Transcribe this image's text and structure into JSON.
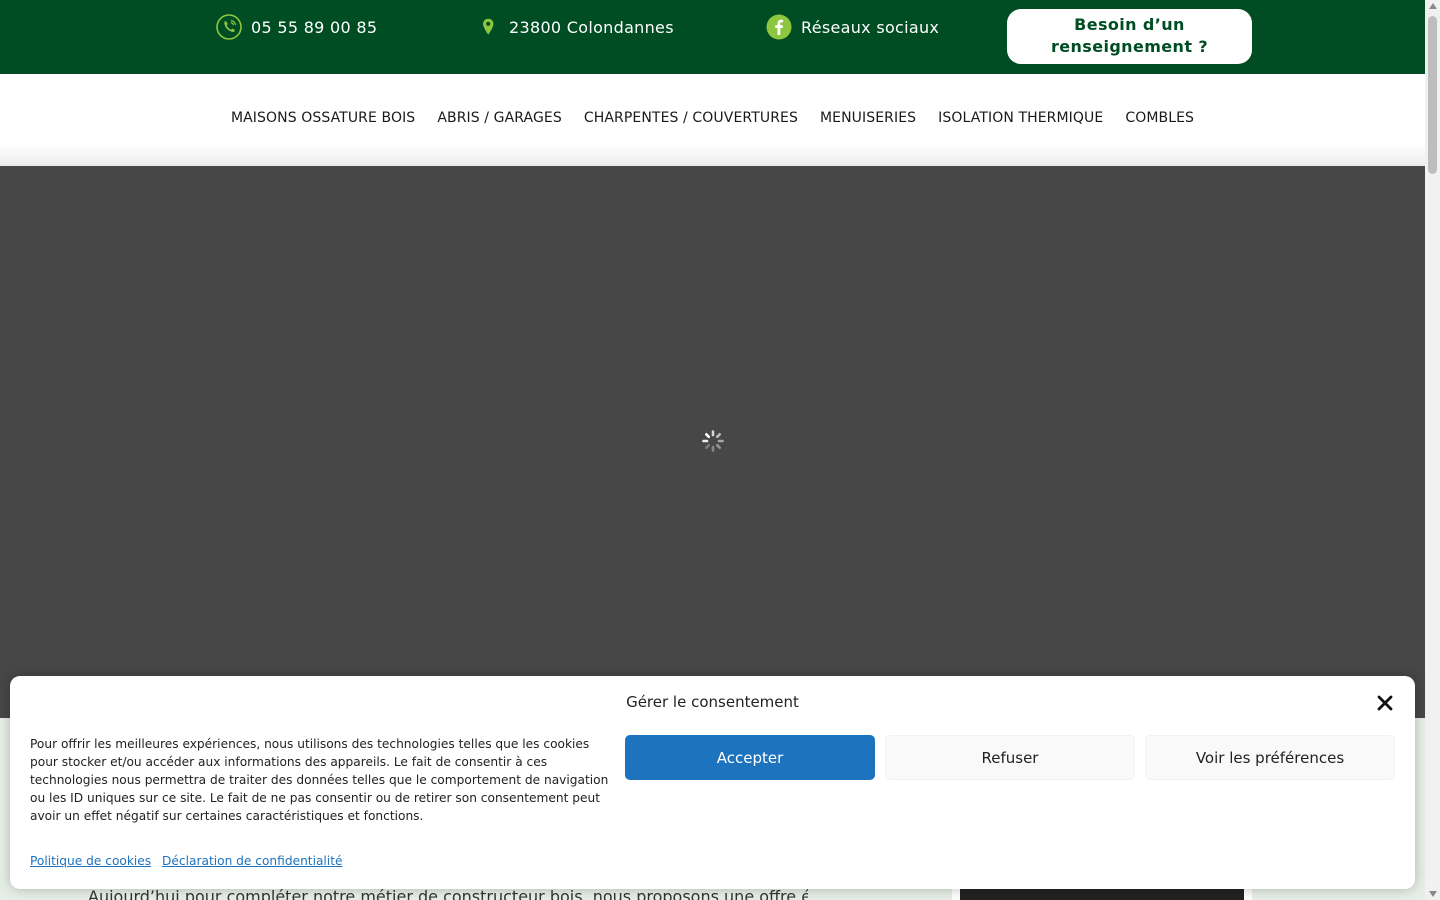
{
  "topbar": {
    "phone": "05 55 89 00 85",
    "address": "23800 Colondannes",
    "social": "Réseaux sociaux",
    "cta_line1": "Besoin d’un",
    "cta_line2": "renseignement ?",
    "icon_color": "#8dc63f",
    "background": "#004d24"
  },
  "nav": {
    "items": [
      {
        "label": "MAISONS OSSATURE BOIS"
      },
      {
        "label": "ABRIS / GARAGES"
      },
      {
        "label": "CHARPENTES / COUVERTURES"
      },
      {
        "label": "MENUISERIES"
      },
      {
        "label": "ISOLATION THERMIQUE"
      },
      {
        "label": "COMBLES"
      }
    ]
  },
  "content": {
    "partial_text": "Aujourd’hui pour compléter notre métier de constructeur bois, nous proposons une offre élargie"
  },
  "consent": {
    "title": "Gérer le consentement",
    "body": "Pour offrir les meilleures expériences, nous utilisons des technologies telles que les cookies pour stocker et/ou accéder aux informations des appareils. Le fait de consentir à ces technologies nous permettra de traiter des données telles que le comportement de navigation ou les ID uniques sur ce site. Le fait de ne pas consentir ou de retirer son consentement peut avoir un effet négatif sur certaines caractéristiques et fonctions.",
    "accept_label": "Accepter",
    "deny_label": "Refuser",
    "prefs_label": "Voir les préférences",
    "cookie_policy_link": "Politique de cookies",
    "privacy_link": "Déclaration de confidentialité",
    "accent_color": "#1e73be"
  }
}
